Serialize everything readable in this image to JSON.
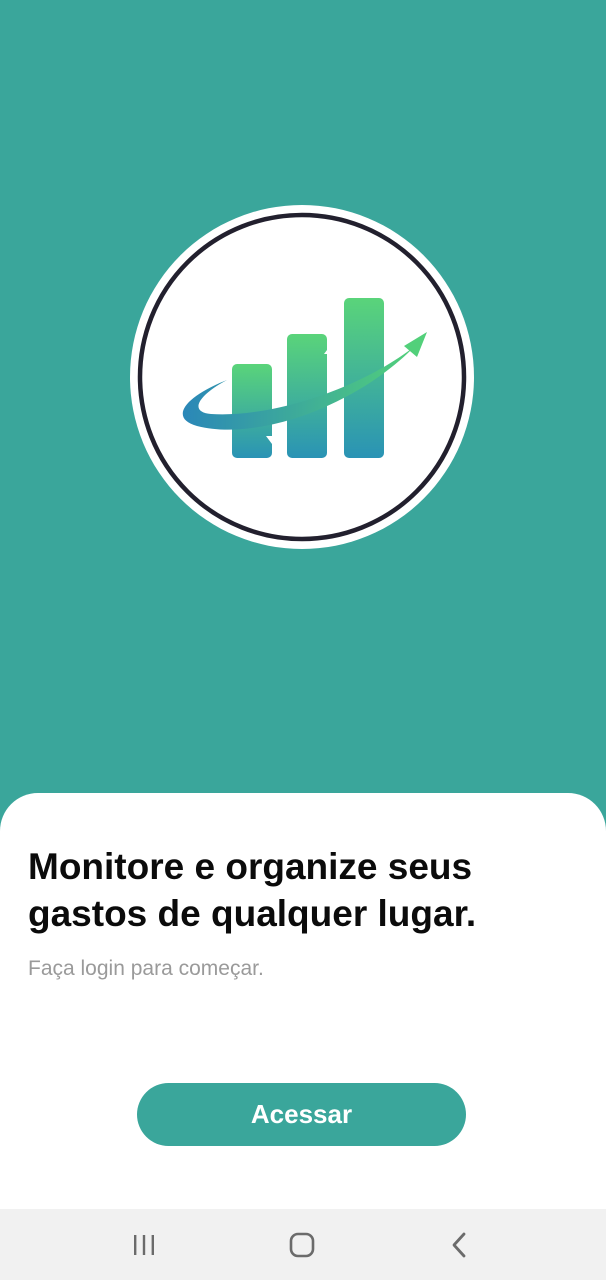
{
  "hero": {
    "background_color": "#3aa69b",
    "logo_icon": "rising-bar-chart-arrow-icon"
  },
  "sheet": {
    "headline": "Monitore e organize seus gastos de qualquer lugar.",
    "subtitle": "Faça login para começar.",
    "cta_label": "Acessar",
    "cta_color": "#3aa69b"
  },
  "system_nav": {
    "recents_icon": "recent-apps-icon",
    "home_icon": "home-icon",
    "back_icon": "back-icon"
  }
}
